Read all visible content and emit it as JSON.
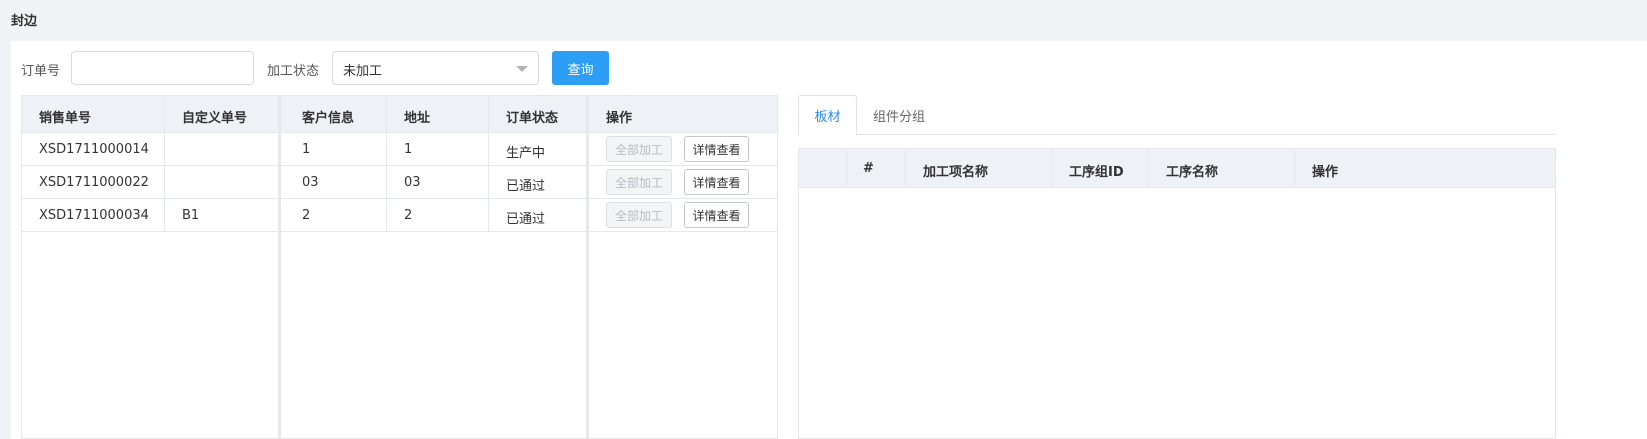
{
  "page": {
    "title": "封边"
  },
  "search": {
    "order_no_label": "订单号",
    "order_no_value": "",
    "status_label": "加工状态",
    "status_selected": "未加工",
    "query_button": "查询"
  },
  "orders_table": {
    "columns": [
      "销售单号",
      "自定义单号",
      "客户信息",
      "地址",
      "订单状态",
      "操作"
    ],
    "rows": [
      {
        "sales_no": "XSD1711000014",
        "custom_no": "",
        "customer": "1",
        "address": "1",
        "status": "生产中"
      },
      {
        "sales_no": "XSD1711000022",
        "custom_no": "",
        "customer": "03",
        "address": "03",
        "status": "已通过"
      },
      {
        "sales_no": "XSD1711000034",
        "custom_no": "B1",
        "customer": "2",
        "address": "2",
        "status": "已通过"
      }
    ],
    "process_all_button": "全部加工",
    "details_button": "详情查看"
  },
  "detail_tabs": {
    "tab1": "板材",
    "tab2": "组件分组"
  },
  "detail_table": {
    "columns": [
      "#",
      "加工项名称",
      "工序组ID",
      "工序名称",
      "操作"
    ]
  }
}
